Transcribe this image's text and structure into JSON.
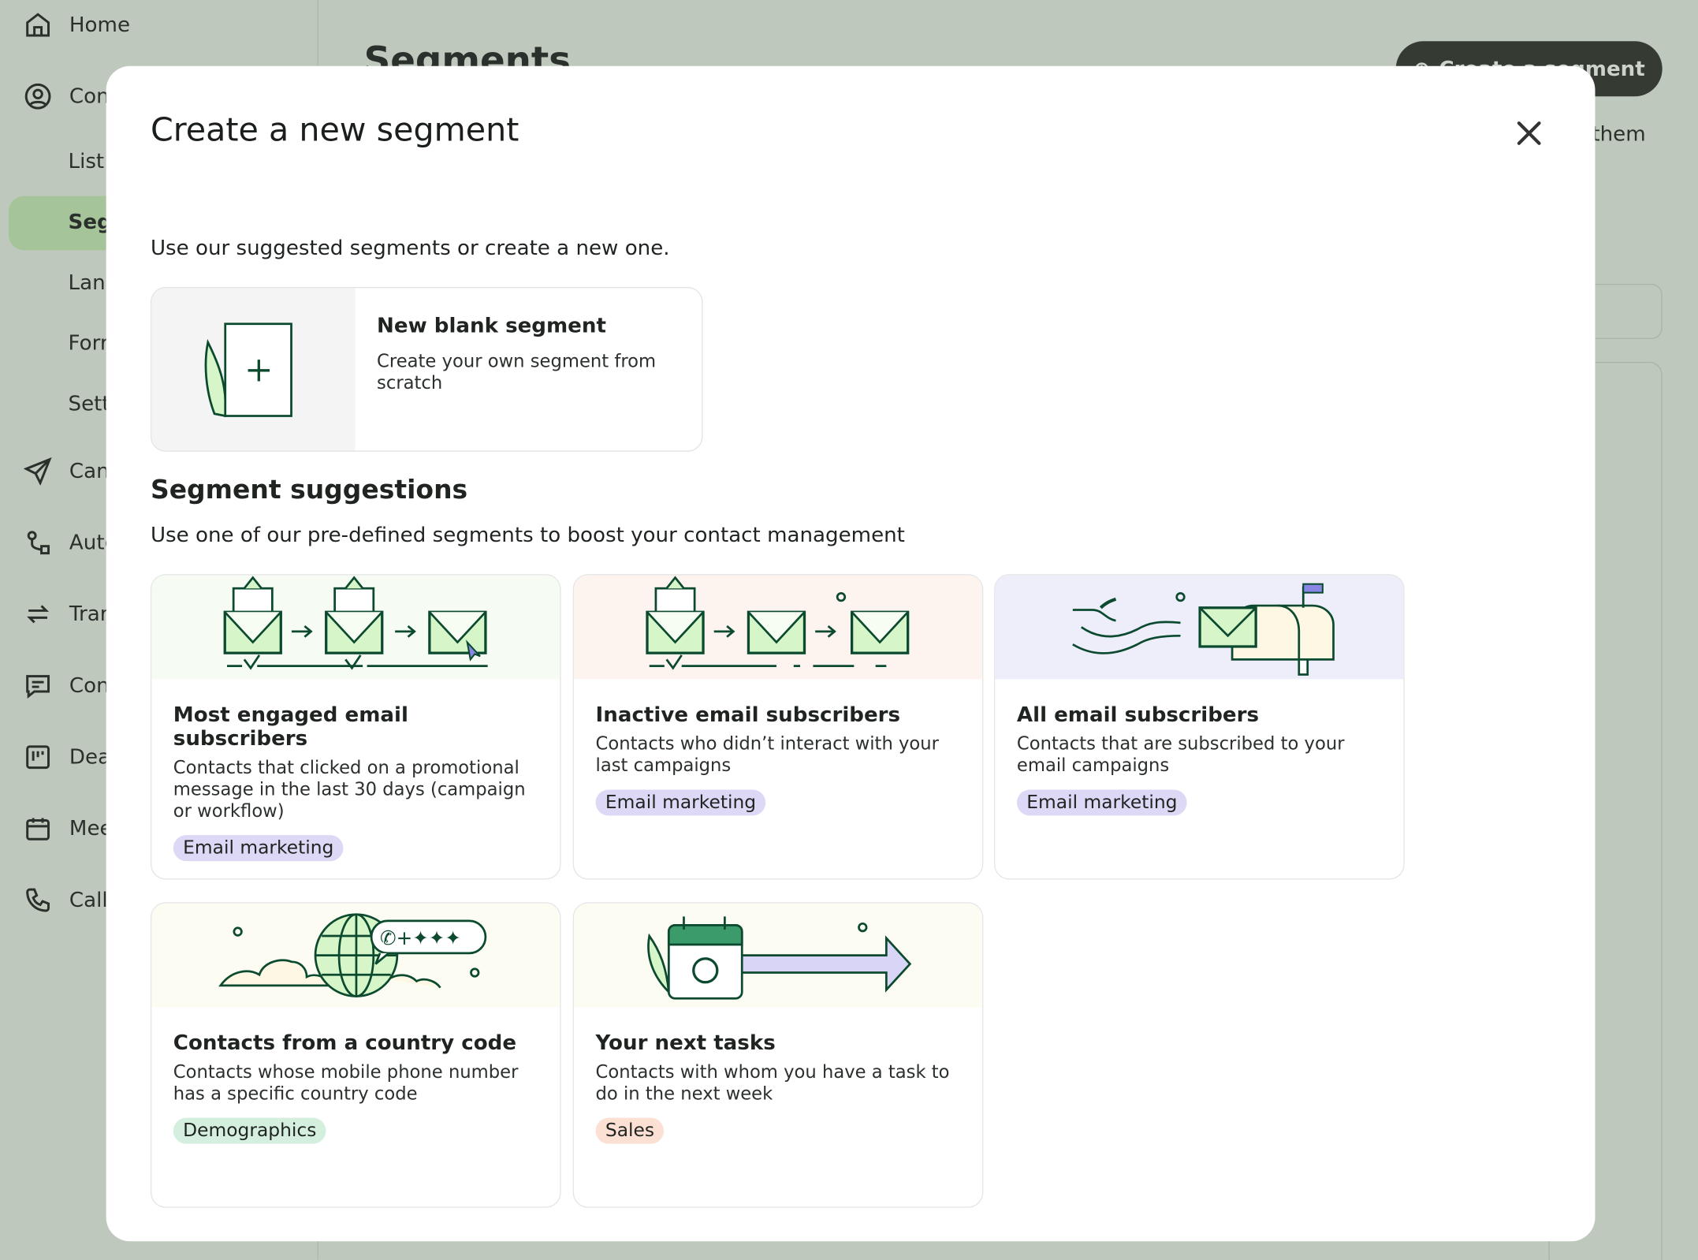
{
  "sidebar": {
    "items": [
      {
        "label": "Home",
        "icon": "home-icon"
      },
      {
        "label": "Con",
        "icon": "contacts-icon"
      },
      {
        "label": "List"
      },
      {
        "label": "Seg",
        "active": true
      },
      {
        "label": "Lan"
      },
      {
        "label": "Forr"
      },
      {
        "label": "Sett"
      },
      {
        "label": "Can",
        "icon": "send-icon"
      },
      {
        "label": "Auto",
        "icon": "automation-icon"
      },
      {
        "label": "Trar",
        "icon": "transactional-icon"
      },
      {
        "label": "Con",
        "icon": "chat-icon"
      },
      {
        "label": "Dea",
        "icon": "deals-icon"
      },
      {
        "label": "Mee",
        "icon": "calendar-icon"
      },
      {
        "label": "Call",
        "icon": "phone-icon"
      }
    ]
  },
  "background": {
    "title": "Segments",
    "create_button": "Create a segment",
    "text": "them"
  },
  "modal": {
    "title": "Create a new segment",
    "intro": "Use our suggested segments or create a new one.",
    "blank": {
      "title": "New blank segment",
      "description": "Create your own segment from scratch"
    },
    "suggestions_title": "Segment suggestions",
    "suggestions_subtitle": "Use one of our pre-defined segments to boost your contact management",
    "cards": [
      {
        "title": "Most engaged email subscribers",
        "description": "Contacts that clicked on a promotional message in the last 30 days (campaign or workflow)",
        "tag": "Email marketing",
        "bg": "#f6fcf3",
        "tag_color": "#dcd8f5"
      },
      {
        "title": "Inactive email subscribers",
        "description": "Contacts who didn’t interact with your last campaigns",
        "tag": "Email marketing",
        "bg": "#fdf3ef",
        "tag_color": "#dcd8f5"
      },
      {
        "title": "All email subscribers",
        "description": "Contacts that are subscribed to your email campaigns",
        "tag": "Email marketing",
        "bg": "#eeeefb",
        "tag_color": "#dcd8f5"
      },
      {
        "title": "Contacts from a country code",
        "description": "Contacts whose mobile phone number has a specific country code",
        "tag": "Demographics",
        "bg": "#fdfcf3",
        "tag_color": "#d5efdf"
      },
      {
        "title": "Your next tasks",
        "description": "Contacts with whom you have a task to do in the next week",
        "tag": "Sales",
        "bg": "#fdfcf3",
        "tag_color": "#fde0d4"
      }
    ]
  },
  "colors": {
    "overlay": "#bfc8bc",
    "accent": "#0b4a2e",
    "active_nav": "#a6c49a"
  }
}
